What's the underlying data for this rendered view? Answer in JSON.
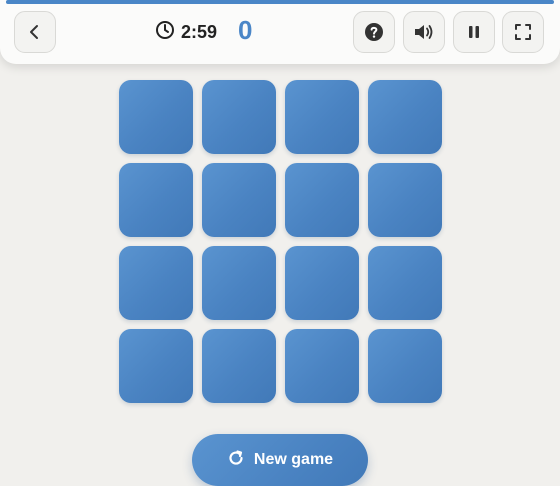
{
  "header": {
    "back_icon": "chevron-left-icon",
    "timer_icon": "clock-icon",
    "timer": "2:59",
    "score": "0",
    "progress": 1.0,
    "buttons": [
      "help-icon",
      "volume-icon",
      "pause-icon",
      "fullscreen-icon"
    ]
  },
  "board": {
    "rows": 4,
    "cols": 4,
    "cards": [
      "",
      "",
      "",
      "",
      "",
      "",
      "",
      "",
      "",
      "",
      "",
      "",
      "",
      "",
      "",
      ""
    ]
  },
  "footer": {
    "new_game_icon": "restart-icon",
    "new_game_label": "New game"
  },
  "colors": {
    "accent": "#4a86c7",
    "card": "#4a83c2",
    "background": "#f1f0ed",
    "topbar": "#fbfbfa"
  }
}
